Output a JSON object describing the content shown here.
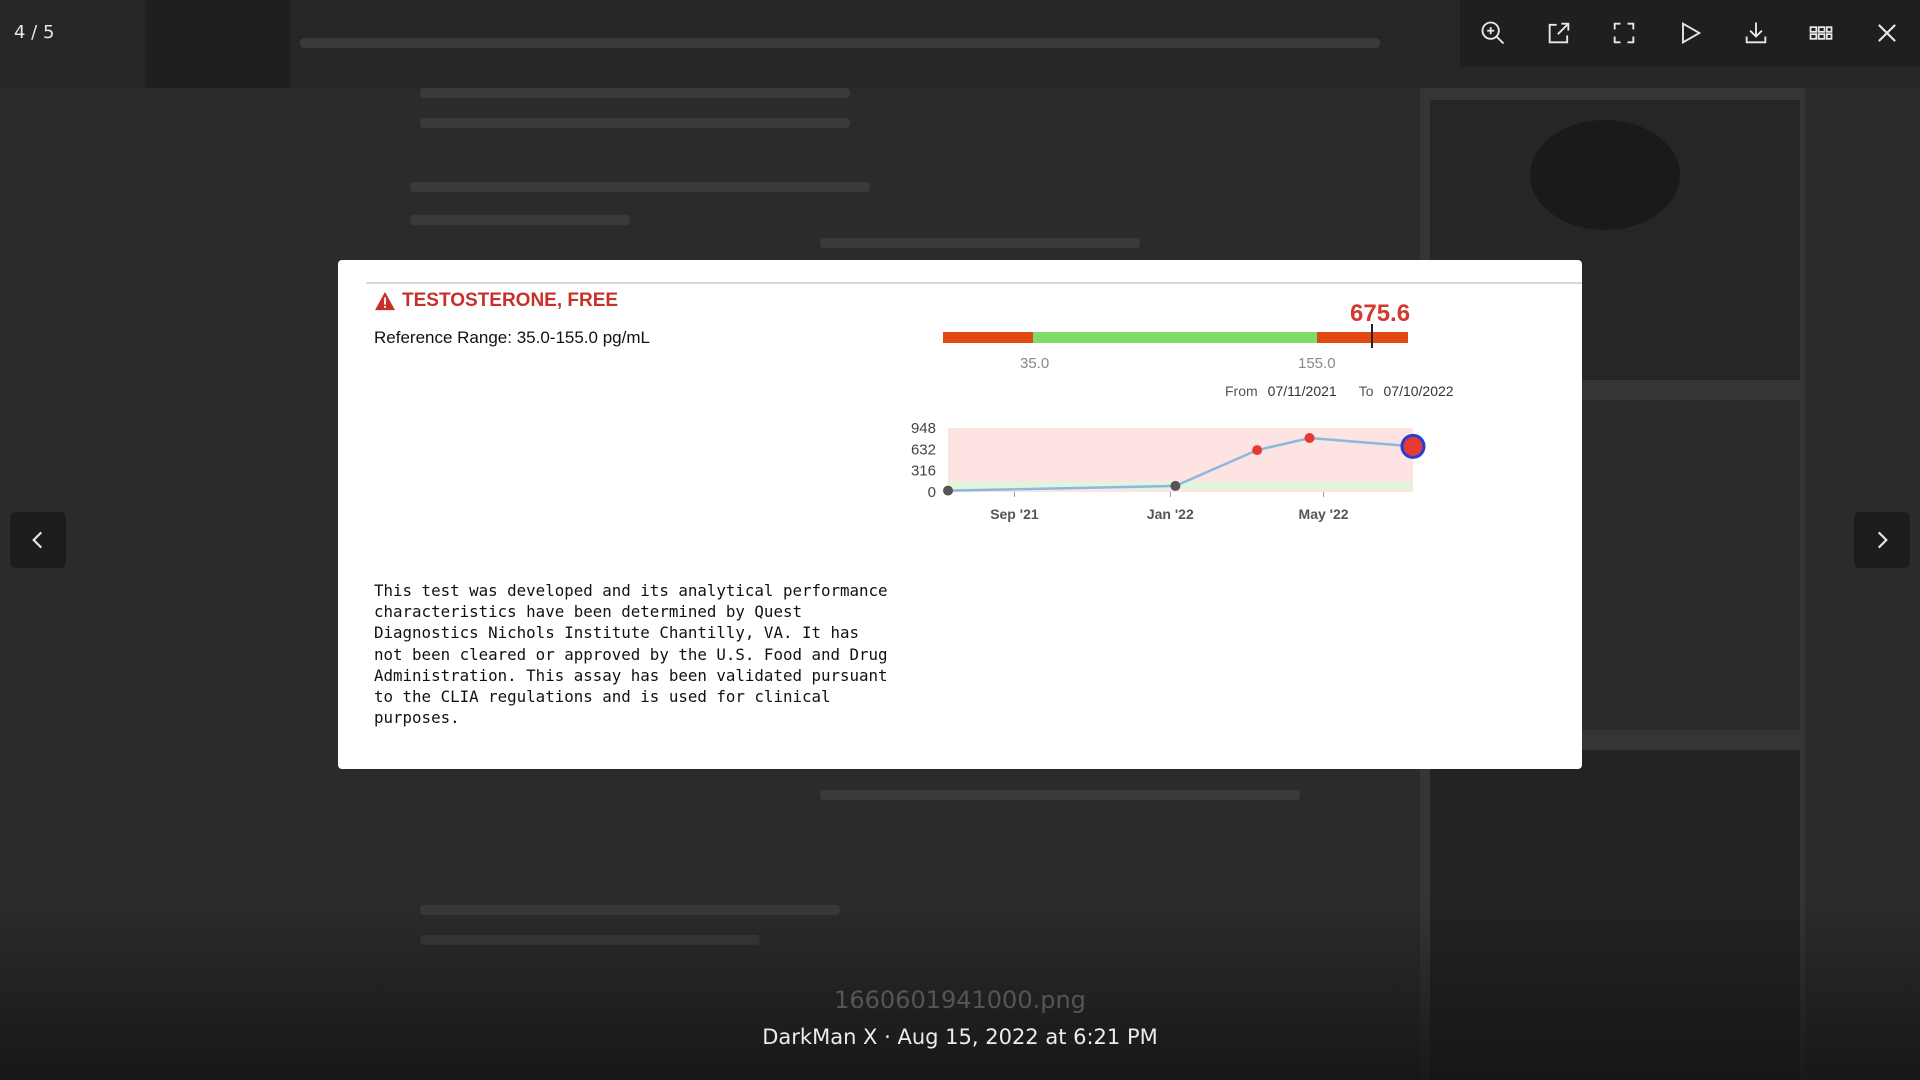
{
  "viewer": {
    "counter": "4 / 5",
    "filename": "1660601941000.png",
    "caption": "DarkMan X · Aug 15, 2022 at 6:21 PM",
    "toolbar": [
      {
        "name": "zoom-in",
        "icon": "zoom-in-icon"
      },
      {
        "name": "open-external",
        "icon": "external-link-icon"
      },
      {
        "name": "fullscreen",
        "icon": "fullscreen-icon"
      },
      {
        "name": "slideshow",
        "icon": "play-icon"
      },
      {
        "name": "download",
        "icon": "download-icon"
      },
      {
        "name": "thumbnails",
        "icon": "grid-icon"
      },
      {
        "name": "close",
        "icon": "close-icon"
      }
    ],
    "nav": {
      "prev_icon": "chevron-left-icon",
      "next_icon": "chevron-right-icon"
    }
  },
  "report": {
    "title": "TESTOSTERONE, FREE",
    "reference_range": "Reference Range: 35.0-155.0 pg/mL",
    "result_value": "675.6",
    "range_low": "35.0",
    "range_high": "155.0",
    "from_label": "From",
    "from_date": "07/11/2021",
    "to_label": "To",
    "to_date": "07/10/2022",
    "disclaimer": "This test was developed and its analytical performance\ncharacteristics have been determined by Quest\nDiagnostics Nichols Institute Chantilly, VA. It has\nnot been cleared or approved by the U.S. Food and Drug\nAdministration. This assay has been validated pursuant\nto the CLIA regulations and is used for clinical\npurposes.",
    "colors": {
      "alert": "#c8302a",
      "out_of_range": "#e04a12",
      "in_range": "#7ddc6a",
      "trend_line": "#8ab8e0"
    }
  },
  "chart_data": {
    "type": "line",
    "title": "",
    "xlabel": "",
    "ylabel": "",
    "x_ticks": [
      "Sep '21",
      "Jan '22",
      "May '22"
    ],
    "y_ticks": [
      "948",
      "632",
      "316",
      "0"
    ],
    "ylim": [
      0,
      948
    ],
    "xlim": [
      "2021-07-11",
      "2022-07-10"
    ],
    "points": [
      {
        "x": "2021-07-11",
        "y": 20,
        "flag": "normal"
      },
      {
        "x": "2022-01-05",
        "y": 90,
        "flag": "normal"
      },
      {
        "x": "2022-03-10",
        "y": 620,
        "flag": "high"
      },
      {
        "x": "2022-04-20",
        "y": 800,
        "flag": "high"
      },
      {
        "x": "2022-07-10",
        "y": 675.6,
        "flag": "high",
        "current": true
      }
    ],
    "normal_band": [
      35.0,
      155.0
    ],
    "grid": false
  }
}
